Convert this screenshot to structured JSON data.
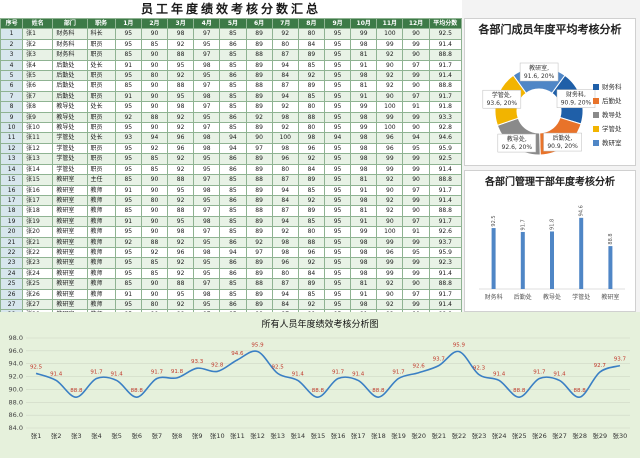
{
  "title": "员工年度绩效考核分数汇总",
  "table": {
    "headers": [
      "序号",
      "姓名",
      "部门",
      "职务",
      "1月",
      "2月",
      "3月",
      "4月",
      "5月",
      "6月",
      "7月",
      "8月",
      "9月",
      "10月",
      "11月",
      "12月",
      "平均分数"
    ],
    "rows": [
      [
        "1",
        "张1",
        "财务科",
        "科长",
        "95",
        "90",
        "98",
        "97",
        "85",
        "89",
        "92",
        "80",
        "95",
        "99",
        "100",
        "90",
        "92.5"
      ],
      [
        "2",
        "张2",
        "财务科",
        "职员",
        "95",
        "85",
        "92",
        "95",
        "86",
        "89",
        "80",
        "84",
        "95",
        "98",
        "99",
        "99",
        "91.4"
      ],
      [
        "3",
        "张3",
        "财务科",
        "职员",
        "85",
        "90",
        "88",
        "97",
        "85",
        "88",
        "87",
        "89",
        "95",
        "81",
        "92",
        "90",
        "88.8"
      ],
      [
        "4",
        "张4",
        "后勤处",
        "处长",
        "91",
        "90",
        "95",
        "98",
        "85",
        "89",
        "94",
        "85",
        "95",
        "91",
        "90",
        "97",
        "91.7"
      ],
      [
        "5",
        "张5",
        "后勤处",
        "职员",
        "95",
        "80",
        "92",
        "95",
        "86",
        "89",
        "84",
        "92",
        "95",
        "98",
        "92",
        "99",
        "91.4"
      ],
      [
        "6",
        "张6",
        "后勤处",
        "职员",
        "85",
        "90",
        "88",
        "97",
        "85",
        "88",
        "87",
        "89",
        "95",
        "81",
        "92",
        "90",
        "88.8"
      ],
      [
        "7",
        "张7",
        "后勤处",
        "职员",
        "91",
        "90",
        "95",
        "98",
        "85",
        "89",
        "94",
        "85",
        "95",
        "91",
        "90",
        "97",
        "91.7"
      ],
      [
        "8",
        "张8",
        "教导处",
        "处长",
        "95",
        "90",
        "98",
        "97",
        "85",
        "89",
        "92",
        "80",
        "95",
        "99",
        "100",
        "91",
        "91.8"
      ],
      [
        "9",
        "张9",
        "教导处",
        "职员",
        "92",
        "88",
        "92",
        "95",
        "86",
        "92",
        "98",
        "88",
        "95",
        "98",
        "99",
        "99",
        "93.3"
      ],
      [
        "10",
        "张10",
        "教导处",
        "职员",
        "95",
        "90",
        "92",
        "97",
        "85",
        "89",
        "92",
        "80",
        "95",
        "99",
        "100",
        "90",
        "92.8"
      ],
      [
        "11",
        "张11",
        "学管处",
        "处长",
        "93",
        "94",
        "96",
        "98",
        "94",
        "90",
        "100",
        "98",
        "94",
        "98",
        "96",
        "94",
        "94.6"
      ],
      [
        "12",
        "张12",
        "学管处",
        "职员",
        "95",
        "92",
        "96",
        "98",
        "94",
        "97",
        "98",
        "96",
        "95",
        "98",
        "96",
        "95",
        "95.9"
      ],
      [
        "13",
        "张13",
        "学管处",
        "职员",
        "95",
        "85",
        "92",
        "95",
        "86",
        "89",
        "96",
        "92",
        "95",
        "98",
        "99",
        "99",
        "92.5"
      ],
      [
        "14",
        "张14",
        "学管处",
        "职员",
        "95",
        "85",
        "92",
        "95",
        "86",
        "89",
        "80",
        "84",
        "95",
        "98",
        "99",
        "99",
        "91.4"
      ],
      [
        "15",
        "张15",
        "教研室",
        "主任",
        "85",
        "90",
        "88",
        "97",
        "85",
        "88",
        "87",
        "89",
        "95",
        "81",
        "92",
        "90",
        "88.8"
      ],
      [
        "16",
        "张16",
        "教研室",
        "教师",
        "91",
        "90",
        "95",
        "98",
        "85",
        "89",
        "94",
        "85",
        "95",
        "91",
        "90",
        "97",
        "91.7"
      ],
      [
        "17",
        "张17",
        "教研室",
        "教师",
        "95",
        "80",
        "92",
        "95",
        "86",
        "89",
        "84",
        "92",
        "95",
        "98",
        "92",
        "99",
        "91.4"
      ],
      [
        "18",
        "张18",
        "教研室",
        "教师",
        "85",
        "90",
        "88",
        "97",
        "85",
        "88",
        "87",
        "89",
        "95",
        "81",
        "92",
        "90",
        "88.8"
      ],
      [
        "19",
        "张19",
        "教研室",
        "教师",
        "91",
        "90",
        "95",
        "98",
        "85",
        "89",
        "94",
        "85",
        "95",
        "91",
        "90",
        "97",
        "91.7"
      ],
      [
        "20",
        "张20",
        "教研室",
        "教师",
        "95",
        "90",
        "98",
        "97",
        "85",
        "89",
        "92",
        "80",
        "95",
        "99",
        "100",
        "91",
        "92.6"
      ],
      [
        "21",
        "张21",
        "教研室",
        "教师",
        "92",
        "88",
        "92",
        "95",
        "86",
        "92",
        "98",
        "88",
        "95",
        "98",
        "99",
        "99",
        "93.7"
      ],
      [
        "22",
        "张22",
        "教研室",
        "教师",
        "95",
        "92",
        "96",
        "98",
        "94",
        "97",
        "98",
        "96",
        "95",
        "98",
        "96",
        "95",
        "95.9"
      ],
      [
        "23",
        "张23",
        "教研室",
        "教师",
        "95",
        "85",
        "92",
        "95",
        "86",
        "89",
        "96",
        "92",
        "95",
        "98",
        "99",
        "99",
        "92.3"
      ],
      [
        "24",
        "张24",
        "教研室",
        "教师",
        "95",
        "85",
        "92",
        "95",
        "86",
        "89",
        "80",
        "84",
        "95",
        "98",
        "99",
        "99",
        "91.4"
      ],
      [
        "25",
        "张25",
        "教研室",
        "教师",
        "85",
        "90",
        "88",
        "97",
        "85",
        "88",
        "87",
        "89",
        "95",
        "81",
        "92",
        "90",
        "88.8"
      ],
      [
        "26",
        "张26",
        "教研室",
        "教师",
        "91",
        "90",
        "95",
        "98",
        "85",
        "89",
        "94",
        "85",
        "95",
        "91",
        "90",
        "97",
        "91.7"
      ],
      [
        "27",
        "张27",
        "教研室",
        "教师",
        "95",
        "80",
        "92",
        "95",
        "86",
        "89",
        "84",
        "92",
        "95",
        "98",
        "92",
        "99",
        "91.4"
      ],
      [
        "28",
        "张28",
        "教研室",
        "教师",
        "85",
        "90",
        "88",
        "97",
        "85",
        "88",
        "87",
        "89",
        "95",
        "81",
        "92",
        "90",
        "88.8"
      ],
      [
        "29",
        "张29",
        "教研室",
        "教师",
        "91",
        "90",
        "95",
        "98",
        "85",
        "89",
        "94",
        "85",
        "95",
        "91",
        "90",
        "97",
        "92.7"
      ],
      [
        "30",
        "张30",
        "教研室",
        "教师",
        "95",
        "85",
        "92",
        "95",
        "86",
        "89",
        "96",
        "92",
        "95",
        "98",
        "99",
        "99",
        "93.7"
      ]
    ]
  },
  "chart_data": [
    {
      "type": "pie",
      "title": "各部门成员年度平均考核分析",
      "categories": [
        "财务科",
        "后勤处",
        "教导处",
        "学管处",
        "教研室"
      ],
      "values": [
        90.9,
        90.9,
        92.6,
        93.6,
        91.6
      ],
      "data_labels": [
        "财务科,\n90.9, 20%",
        "后勤处,\n90.9, 20%",
        "教导处,\n92.6, 20%",
        "学管处,\n93.6, 20%",
        "教研室,\n91.6, 20%"
      ],
      "colors": [
        "#1f5fa8",
        "#e8732a",
        "#8a8a8a",
        "#f2b400",
        "#4f86c6"
      ],
      "legend": "right",
      "donut": true
    },
    {
      "type": "bar",
      "title": "各部门管理干部年度考核分析",
      "categories": [
        "财务科",
        "后勤处",
        "教导处",
        "学管处",
        "教研室"
      ],
      "values": [
        92.5,
        91.7,
        91.8,
        94.6,
        88.8
      ],
      "ylim": [
        80,
        96
      ],
      "color": "#4f86c6"
    },
    {
      "type": "line",
      "title": "所有人员年度绩效考核分析图",
      "categories": [
        "张1",
        "张2",
        "张3",
        "张4",
        "张5",
        "张6",
        "张7",
        "张8",
        "张9",
        "张10",
        "张11",
        "张12",
        "张13",
        "张14",
        "张15",
        "张16",
        "张17",
        "张18",
        "张19",
        "张20",
        "张21",
        "张22",
        "张23",
        "张24",
        "张25",
        "张26",
        "张27",
        "张28",
        "张29",
        "张30"
      ],
      "values": [
        92.5,
        91.4,
        88.8,
        91.7,
        91.4,
        88.8,
        91.7,
        91.8,
        93.3,
        92.8,
        94.6,
        95.9,
        92.5,
        91.4,
        88.8,
        91.7,
        91.4,
        88.8,
        91.7,
        92.6,
        93.7,
        95.9,
        92.3,
        91.4,
        88.8,
        91.7,
        91.4,
        88.8,
        92.7,
        93.7
      ],
      "yticks": [
        "84.0",
        "86.0",
        "88.0",
        "90.0",
        "92.0",
        "94.0",
        "96.0",
        "98.0"
      ],
      "ylim": [
        84,
        98
      ],
      "line_color": "#3a7fc4",
      "label_color": "#c0392b",
      "grid": true
    }
  ]
}
